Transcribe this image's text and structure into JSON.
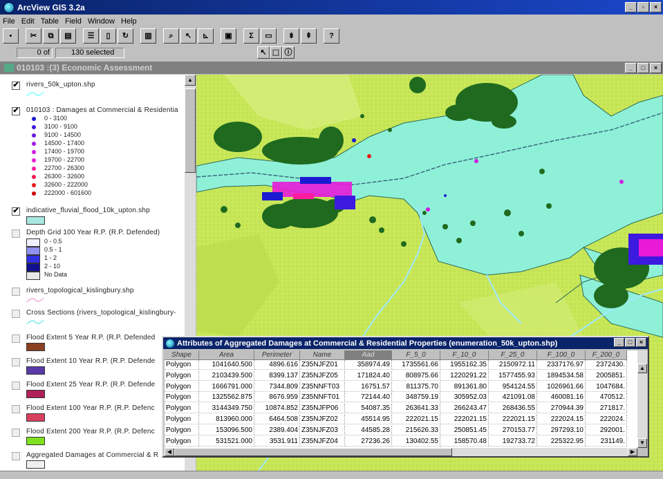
{
  "app": {
    "title": "ArcView GIS 3.2a"
  },
  "menu": [
    "File",
    "Edit",
    "Table",
    "Field",
    "Window",
    "Help"
  ],
  "status": {
    "count": "0 of",
    "selected": "130 selected"
  },
  "view": {
    "title": "010103 :(3) Economic Assessment"
  },
  "toc": {
    "layers": [
      {
        "name": "rivers_50k_upton.shp",
        "checked": true
      },
      {
        "name": "010103 : Damages at Commercial & Residentia",
        "checked": true,
        "classes": [
          {
            "label": "0 - 3100",
            "color": "#1a1ad0"
          },
          {
            "label": "3100 - 9100",
            "color": "#3c1ae0"
          },
          {
            "label": "9100 - 14500",
            "color": "#6a1ae0"
          },
          {
            "label": "14500 - 17400",
            "color": "#a01ae8"
          },
          {
            "label": "17400 - 19700",
            "color": "#d01ae0"
          },
          {
            "label": "19700 - 22700",
            "color": "#e81ad8"
          },
          {
            "label": "22700 - 26300",
            "color": "#ff1aa0"
          },
          {
            "label": "26300 - 32600",
            "color": "#f01a50"
          },
          {
            "label": "32600 - 222000",
            "color": "#e81a1a"
          },
          {
            "label": "222000 - 601600",
            "color": "#d00000"
          }
        ]
      },
      {
        "name": "indicative_fluvial_flood_10k_upton.shp",
        "checked": true
      },
      {
        "name": "Depth Grid 100 Year R.P. (R.P. Defended)",
        "checked": false,
        "classes": [
          {
            "label": "0 - 0.5",
            "color": "#f0f0ff"
          },
          {
            "label": "0.5 - 1",
            "color": "#9090f0"
          },
          {
            "label": "1 - 2",
            "color": "#3030e0"
          },
          {
            "label": "2 - 10",
            "color": "#101090"
          },
          {
            "label": "No Data",
            "color": "#e8e8e8"
          }
        ]
      },
      {
        "name": "rivers_topological_kislingbury.shp",
        "checked": false
      },
      {
        "name": "Cross Sections (rivers_topological_kislingbury-",
        "checked": false
      },
      {
        "name": "Flood Extent 5 Year R.P. (R.P. Defended",
        "checked": false,
        "color": "#8a4020"
      },
      {
        "name": "Flood Extent 10 Year R.P. (R.P. Defende",
        "checked": false,
        "color": "#5a3aa8"
      },
      {
        "name": "Flood Extent 25 Year R.P. (R.P. Defende",
        "checked": false,
        "color": "#b0205a"
      },
      {
        "name": "Flood Extent 100 Year R.P. (R.P. Defenc",
        "checked": false,
        "color": "#d84060"
      },
      {
        "name": "Flood Extent 200 Year R.P. (R.P. Defenc",
        "checked": false,
        "color": "#80e020"
      },
      {
        "name": "Aggregated Damages at Commercial & R",
        "checked": false
      }
    ]
  },
  "attributes": {
    "title": "Attributes of Aggregated Damages at Commercial & Residential Properties (enumeration_50k_upton.shp)",
    "columns": [
      "Shape",
      "Area",
      "Perimeter",
      "Name",
      "Aad",
      "F_5_0",
      "F_10_0",
      "F_25_0",
      "F_100_0",
      "F_200_0"
    ],
    "rows": [
      [
        "Polygon",
        "1041640.500",
        "4896.616",
        "Z35NJFZ01",
        "358974.49",
        "1735561.66",
        "1955162.35",
        "2150972.11",
        "2337176.97",
        "2372430."
      ],
      [
        "Polygon",
        "2103439.500",
        "8399.137",
        "Z35NJFZ05",
        "171824.40",
        "808975.66",
        "1220291.22",
        "1577455.93",
        "1894534.58",
        "2005851."
      ],
      [
        "Polygon",
        "1666791.000",
        "7344.809",
        "Z35NNFT03",
        "16751.57",
        "811375.70",
        "891361.80",
        "954124.55",
        "1026961.66",
        "1047684."
      ],
      [
        "Polygon",
        "1325562.875",
        "8676.959",
        "Z35NNFT01",
        "72144.40",
        "348759.19",
        "305952.03",
        "421091.08",
        "460081.16",
        "470512."
      ],
      [
        "Polygon",
        "3144349.750",
        "10874.852",
        "Z35NJFP06",
        "54087.35",
        "263641.33",
        "266243.47",
        "268436.55",
        "270944.39",
        "271817."
      ],
      [
        "Polygon",
        "813960.000",
        "6464.508",
        "Z35NJFZ02",
        "45514.95",
        "222021.15",
        "222021.15",
        "222021.15",
        "222024.15",
        "222024."
      ],
      [
        "Polygon",
        "153096.500",
        "2389.404",
        "Z35NJFZ03",
        "44585.28",
        "215626.33",
        "250851.45",
        "270153.77",
        "297293.10",
        "292001."
      ],
      [
        "Polygon",
        "531521.000",
        "3531.911",
        "Z35NJFZ04",
        "27236.26",
        "130402.55",
        "158570.48",
        "192733.72",
        "225322.95",
        "231149."
      ]
    ]
  },
  "colors": {
    "title_bar": "#0a246a",
    "flood": "#8ff0d8",
    "background_land": "#c8e85a",
    "buildings": "#1f6a1f"
  }
}
